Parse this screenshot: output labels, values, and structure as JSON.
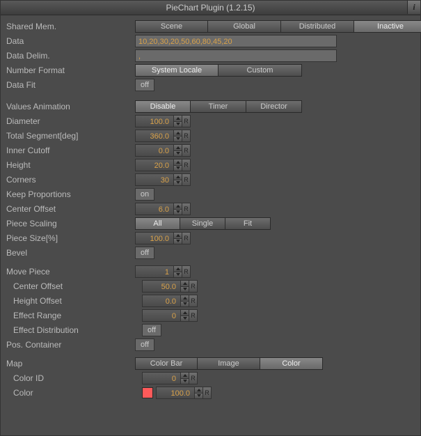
{
  "title": "PieChart Plugin (1.2.15)",
  "info": "i",
  "sharedMem": {
    "label": "Shared Mem.",
    "options": {
      "scene": "Scene",
      "global": "Global",
      "distributed": "Distributed",
      "inactive": "Inactive"
    }
  },
  "dataRow": {
    "label": "Data",
    "value": "10,20,30,20,50,60,80,45,20"
  },
  "dataDelim": {
    "label": "Data Delim.",
    "value": ","
  },
  "numberFormat": {
    "label": "Number Format",
    "options": {
      "system": "System Locale",
      "custom": "Custom"
    }
  },
  "dataFit": {
    "label": "Data Fit",
    "value": "off"
  },
  "valuesAnim": {
    "label": "Values Animation",
    "options": {
      "disable": "Disable",
      "timer": "Timer",
      "director": "Director"
    }
  },
  "diameter": {
    "label": "Diameter",
    "value": "100.0"
  },
  "totalSegment": {
    "label": "Total Segment[deg]",
    "value": "360.0"
  },
  "innerCutoff": {
    "label": "Inner Cutoff",
    "value": "0.0"
  },
  "height": {
    "label": "Height",
    "value": "20.0"
  },
  "corners": {
    "label": "Corners",
    "value": "30"
  },
  "keepProp": {
    "label": "Keep Proportions",
    "value": "on"
  },
  "centerOffset": {
    "label": "Center Offset",
    "value": "6.0"
  },
  "pieceScaling": {
    "label": "Piece Scaling",
    "options": {
      "all": "All",
      "single": "Single",
      "fit": "Fit"
    }
  },
  "pieceSize": {
    "label": "Piece Size[%]",
    "value": "100.0"
  },
  "bevel": {
    "label": "Bevel",
    "value": "off"
  },
  "movePiece": {
    "label": "Move Piece",
    "value": "1"
  },
  "mpCenterOffset": {
    "label": "Center Offset",
    "value": "50.0"
  },
  "mpHeightOffset": {
    "label": "Height Offset",
    "value": "0.0"
  },
  "mpEffectRange": {
    "label": "Effect Range",
    "value": "0"
  },
  "mpEffectDist": {
    "label": "Effect Distribution",
    "value": "off"
  },
  "posContainer": {
    "label": "Pos. Container",
    "value": "off"
  },
  "map": {
    "label": "Map",
    "options": {
      "colorBar": "Color Bar",
      "image": "Image",
      "color": "Color"
    }
  },
  "colorId": {
    "label": "Color ID",
    "value": "0"
  },
  "color": {
    "label": "Color",
    "value": "100.0",
    "swatch": "#ff5a5a"
  },
  "reset": "R",
  "chart_data": {
    "type": "pie",
    "values": [
      10,
      20,
      30,
      20,
      50,
      60,
      80,
      45,
      20
    ],
    "title": "",
    "xlabel": "",
    "ylabel": ""
  }
}
